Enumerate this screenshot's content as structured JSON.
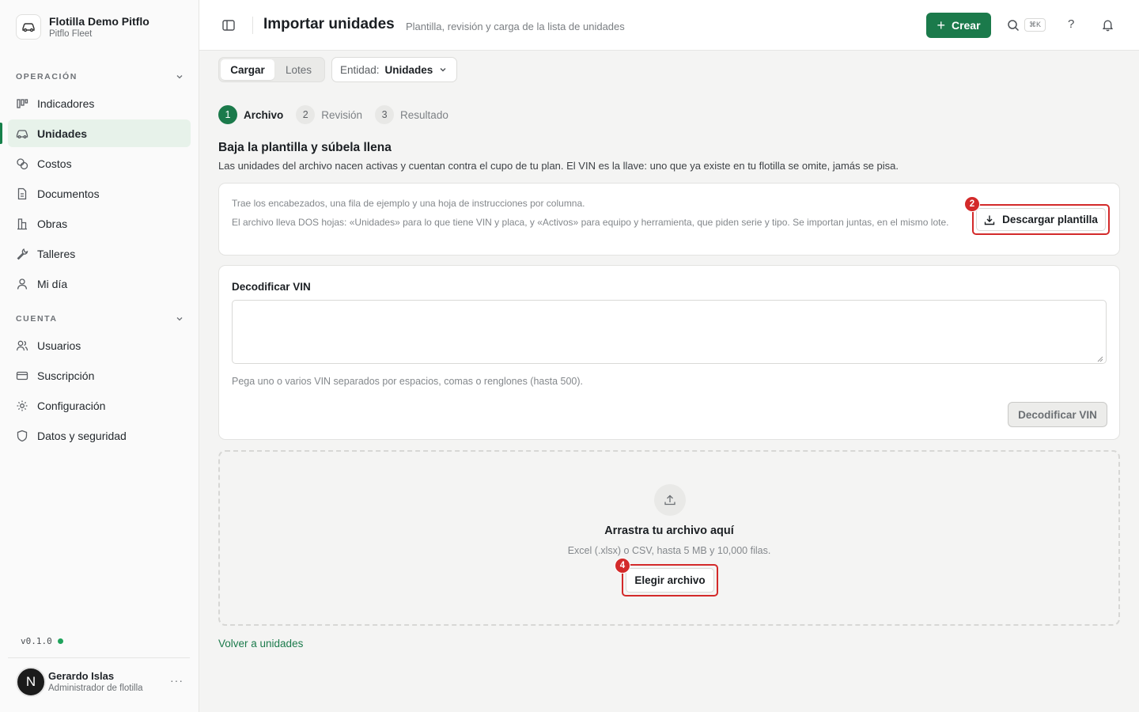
{
  "brand": {
    "name": "Flotilla Demo Pitflo",
    "subtitle": "Pitflo Fleet"
  },
  "sidebar": {
    "sections": [
      {
        "title": "OPERACIÓN",
        "items": [
          {
            "label": "Indicadores",
            "icon": "chart-icon"
          },
          {
            "label": "Unidades",
            "icon": "car-icon",
            "active": true
          },
          {
            "label": "Costos",
            "icon": "coins-icon"
          },
          {
            "label": "Documentos",
            "icon": "document-icon"
          },
          {
            "label": "Obras",
            "icon": "building-icon"
          },
          {
            "label": "Talleres",
            "icon": "wrench-icon"
          },
          {
            "label": "Mi día",
            "icon": "user-icon"
          }
        ]
      },
      {
        "title": "CUENTA",
        "items": [
          {
            "label": "Usuarios",
            "icon": "users-icon"
          },
          {
            "label": "Suscripción",
            "icon": "card-icon"
          },
          {
            "label": "Configuración",
            "icon": "gear-icon"
          },
          {
            "label": "Datos y seguridad",
            "icon": "shield-icon"
          }
        ]
      }
    ],
    "version": "v0.1.0",
    "user": {
      "initial": "N",
      "name": "Gerardo Islas",
      "role": "Administrador de flotilla",
      "more": "···"
    }
  },
  "header": {
    "title": "Importar unidades",
    "subtitle": "Plantilla, revisión y carga de la lista de unidades",
    "create_label": "Crear",
    "shortcut": "⌘K",
    "help": "?"
  },
  "toolbar": {
    "tabs": [
      {
        "label": "Cargar",
        "active": true
      },
      {
        "label": "Lotes"
      }
    ],
    "entity_label": "Entidad:",
    "entity_value": "Unidades"
  },
  "steps": [
    {
      "num": "1",
      "label": "Archivo",
      "active": true
    },
    {
      "num": "2",
      "label": "Revisión"
    },
    {
      "num": "3",
      "label": "Resultado"
    }
  ],
  "intro": {
    "title": "Baja la plantilla y súbela llena",
    "description": "Las unidades del archivo nacen activas y cuentan contra el cupo de tu plan. El VIN es la llave: uno que ya existe en tu flotilla se omite, jamás se pisa."
  },
  "template_card": {
    "line1": "Trae los encabezados, una fila de ejemplo y una hoja de instrucciones por columna.",
    "line2": "El archivo lleva DOS hojas: «Unidades» para lo que tiene VIN y placa, y «Activos» para equipo y herramienta, que piden serie y tipo. Se importan juntas, en el mismo lote.",
    "download_label": "Descargar plantilla",
    "badge": "2"
  },
  "vin_card": {
    "title": "Decodificar VIN",
    "value": "",
    "help": "Pega uno o varios VIN separados por espacios, comas o renglones (hasta 500).",
    "button": "Decodificar VIN"
  },
  "dropzone": {
    "title": "Arrastra tu archivo aquí",
    "subtitle": "Excel (.xlsx) o CSV, hasta 5 MB y 10,000 filas.",
    "button": "Elegir archivo",
    "badge": "4"
  },
  "back_link": "Volver a unidades",
  "colors": {
    "accent": "#1b7a4b",
    "highlight": "#d32a2a"
  }
}
